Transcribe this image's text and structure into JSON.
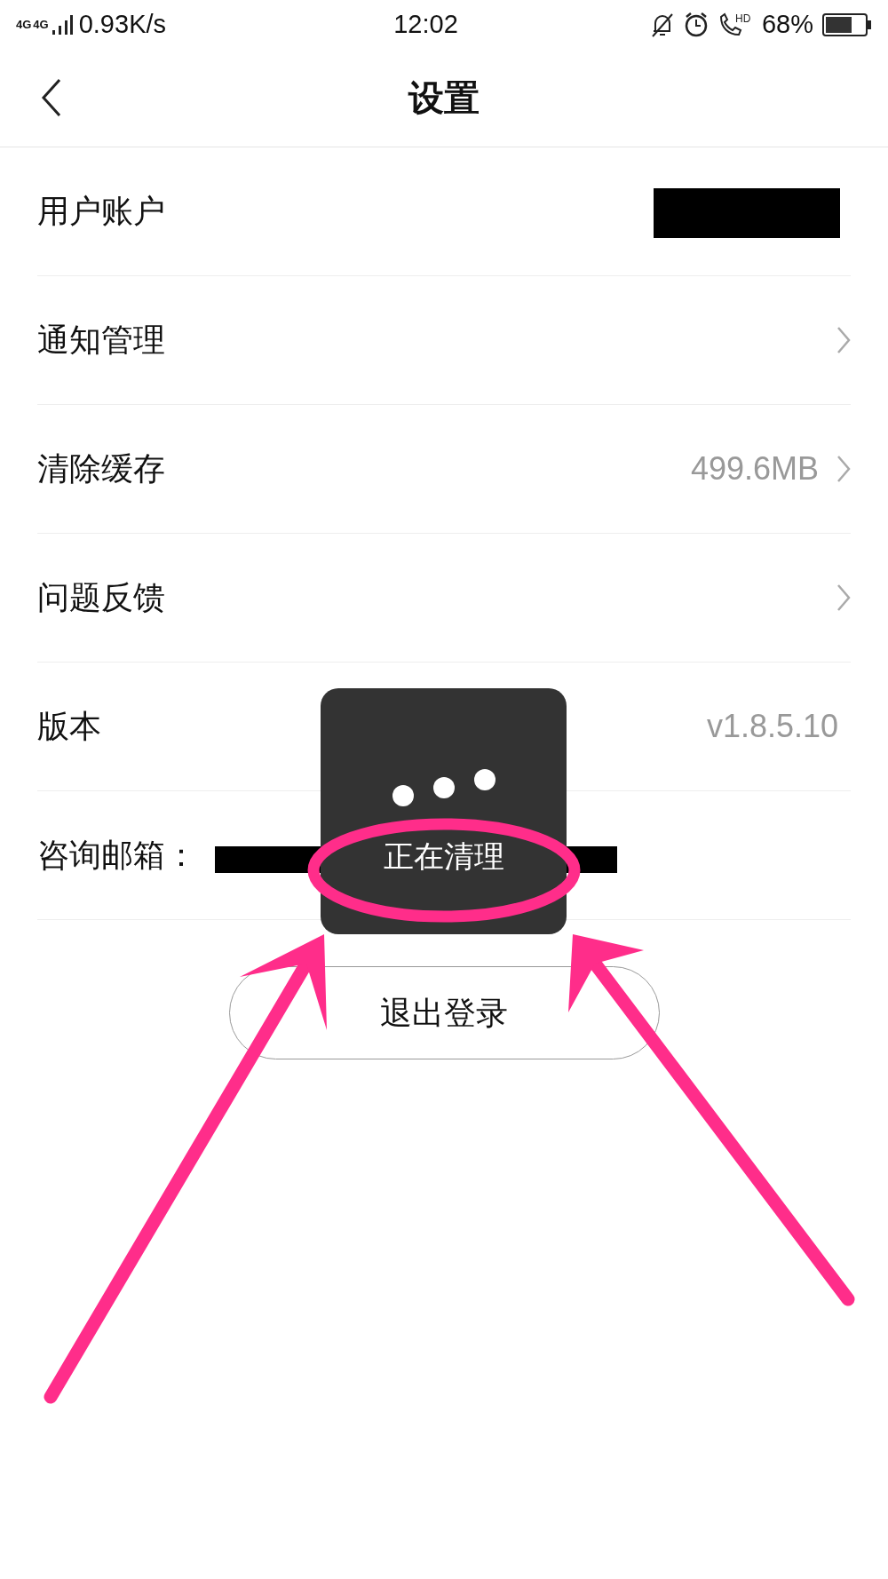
{
  "status_bar": {
    "network": [
      "4G",
      "4G"
    ],
    "speed": "0.93K/s",
    "time": "12:02",
    "call_label": "HD",
    "battery": "68%"
  },
  "header": {
    "title": "设置"
  },
  "rows": [
    {
      "label": "用户账户",
      "redacted": true,
      "chevron": false
    },
    {
      "label": "通知管理",
      "chevron": true
    },
    {
      "label": "清除缓存",
      "value": "499.6MB",
      "chevron": true
    },
    {
      "label": "问题反馈",
      "chevron": true
    },
    {
      "label": "版本",
      "value": "v1.8.5.10",
      "chevron": false
    },
    {
      "label": "咨询邮箱：",
      "redacted": true,
      "chevron": false
    }
  ],
  "toast": {
    "text": "正在清理"
  },
  "logout": {
    "label": "退出登录"
  }
}
